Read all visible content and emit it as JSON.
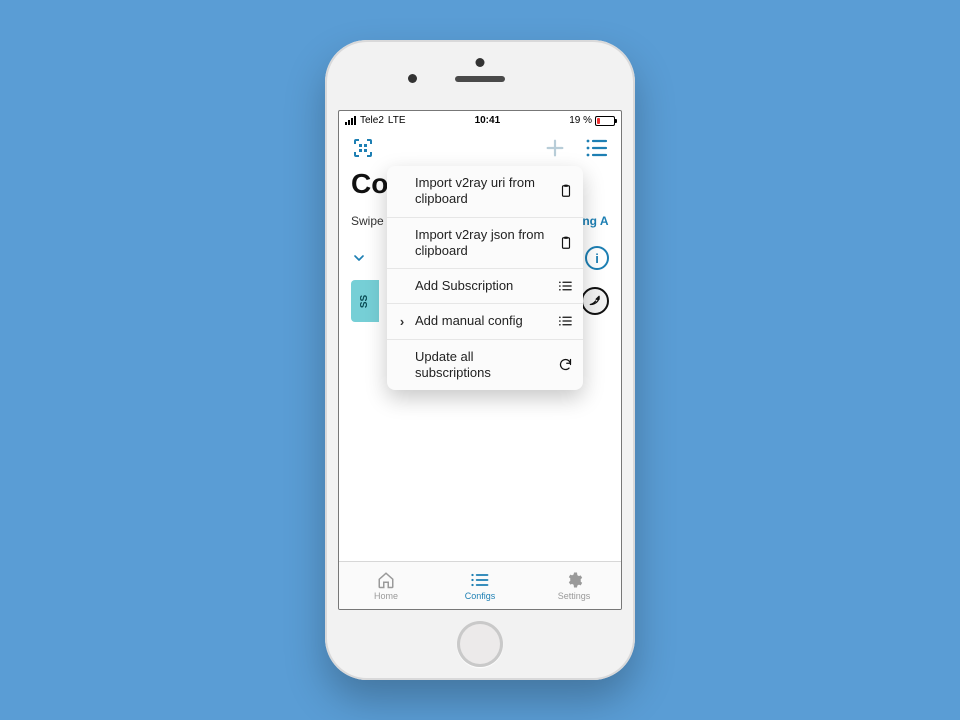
{
  "status": {
    "carrier": "Tele2",
    "network": "LTE",
    "time": "10:41",
    "battery_pct": "19 %"
  },
  "toolbar": {
    "scan": "scan",
    "add": "add",
    "menu": "menu"
  },
  "page": {
    "title": "Configs",
    "swipe_hint": "Swipe",
    "ping_all": "Ping All",
    "ss_badge": "SS"
  },
  "popover": {
    "items": [
      {
        "label": "Import v2ray uri from clipboard",
        "icon": "clipboard",
        "chevron": false
      },
      {
        "label": "Import v2ray json from clipboard",
        "icon": "clipboard",
        "chevron": false
      },
      {
        "label": "Add Subscription",
        "icon": "list",
        "chevron": false
      },
      {
        "label": "Add manual config",
        "icon": "list",
        "chevron": true
      },
      {
        "label": "Update all subscriptions",
        "icon": "refresh",
        "chevron": false
      }
    ]
  },
  "tabs": {
    "home": "Home",
    "configs": "Configs",
    "settings": "Settings"
  },
  "colors": {
    "accent": "#1d7fb3"
  }
}
